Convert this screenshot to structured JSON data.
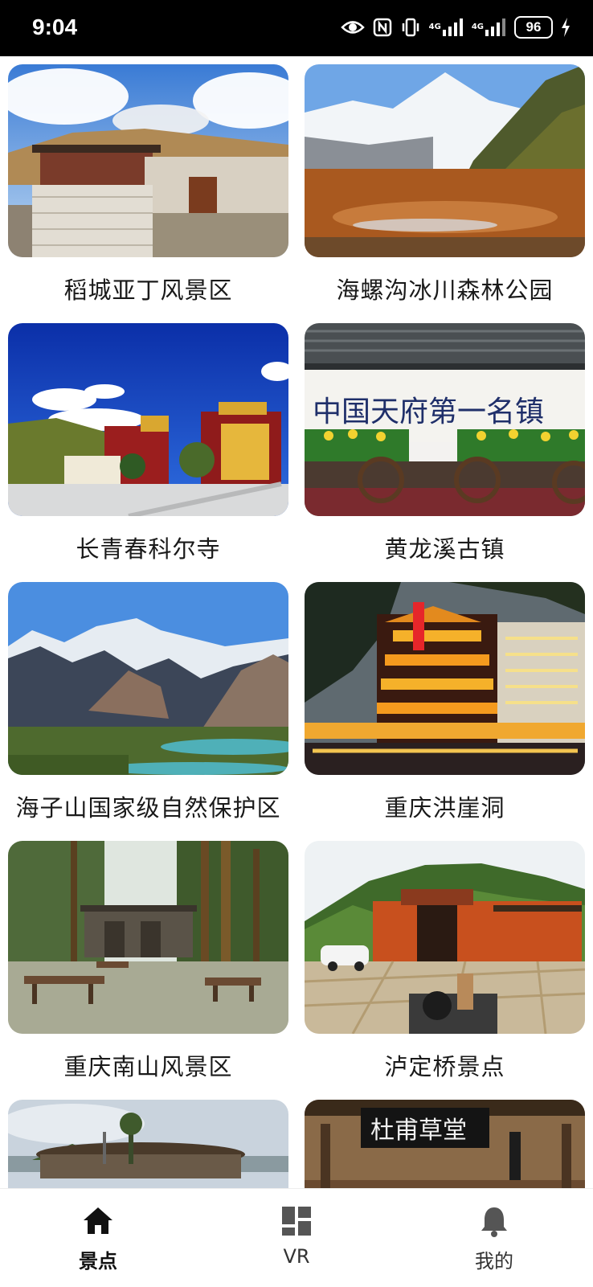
{
  "status_bar": {
    "time": "9:04",
    "network_1": "4G",
    "network_2": "4G",
    "battery": "96"
  },
  "spots": [
    {
      "name": "稻城亚丁风景区"
    },
    {
      "name": "海螺沟冰川森林公园"
    },
    {
      "name": "长青春科尔寺"
    },
    {
      "name": "黄龙溪古镇",
      "sign_text": "中国天府第一名镇"
    },
    {
      "name": "海子山国家级自然保护区"
    },
    {
      "name": "重庆洪崖洞"
    },
    {
      "name": "重庆南山风景区"
    },
    {
      "name": "泸定桥景点"
    },
    {
      "name": ""
    },
    {
      "name": "",
      "sign_text": "杜甫草堂"
    }
  ],
  "nav": [
    {
      "label": "景点",
      "icon": "home-icon",
      "active": true
    },
    {
      "label": "VR",
      "icon": "grid-icon",
      "active": false
    },
    {
      "label": "我的",
      "icon": "bell-icon",
      "active": false
    }
  ]
}
